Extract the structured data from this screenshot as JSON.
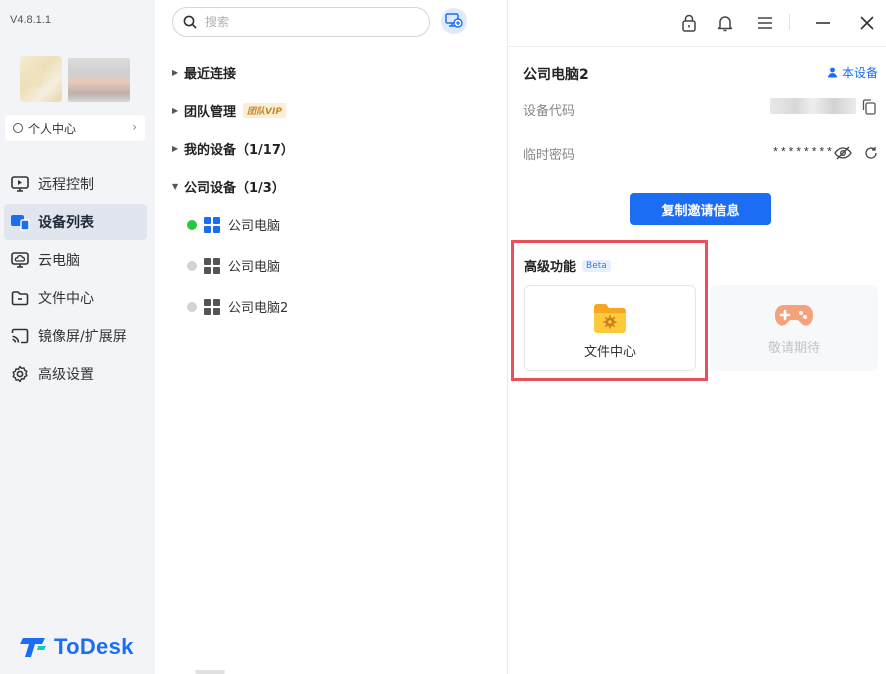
{
  "app": {
    "version": "V4.8.1.1",
    "brand": "ToDesk",
    "accent_color": "#1b6ef3"
  },
  "sidebar": {
    "personal_center": "个人中心",
    "items": [
      {
        "label": "远程控制",
        "icon": "monitor-icon",
        "active": false
      },
      {
        "label": "设备列表",
        "icon": "device-list-icon",
        "active": true
      },
      {
        "label": "云电脑",
        "icon": "cloud-pc-icon",
        "active": false
      },
      {
        "label": "文件中心",
        "icon": "folder-icon",
        "active": false
      },
      {
        "label": "镜像屏/扩展屏",
        "icon": "cast-icon",
        "active": false
      },
      {
        "label": "高级设置",
        "icon": "gear-icon",
        "active": false
      }
    ]
  },
  "search": {
    "placeholder": "搜索"
  },
  "device_tree": {
    "groups": [
      {
        "label": "最近连接",
        "expanded": false
      },
      {
        "label": "团队管理",
        "badge": "团队VIP",
        "expanded": false
      },
      {
        "label": "我的设备（1/17）",
        "expanded": false
      },
      {
        "label": "公司设备（1/3）",
        "expanded": true
      }
    ],
    "devices": [
      {
        "name": "公司电脑",
        "online": true
      },
      {
        "name": "公司电脑",
        "online": false
      },
      {
        "name": "公司电脑2",
        "online": false
      }
    ]
  },
  "detail": {
    "device_name": "公司电脑2",
    "this_device": "本设备",
    "device_code_label": "设备代码",
    "temp_password_label": "临时密码",
    "temp_password_value": "********",
    "copy_invite_button": "复制邀请信息",
    "advanced_title": "高级功能",
    "beta_badge": "Beta",
    "features": [
      {
        "label": "文件中心",
        "icon": "folder-gear-icon",
        "enabled": true
      },
      {
        "label": "敬请期待",
        "icon": "gamepad-icon",
        "enabled": false
      }
    ]
  },
  "colors": {
    "online": "#28c840",
    "offline": "#cfd3d8",
    "highlight_border": "#e8505b"
  }
}
